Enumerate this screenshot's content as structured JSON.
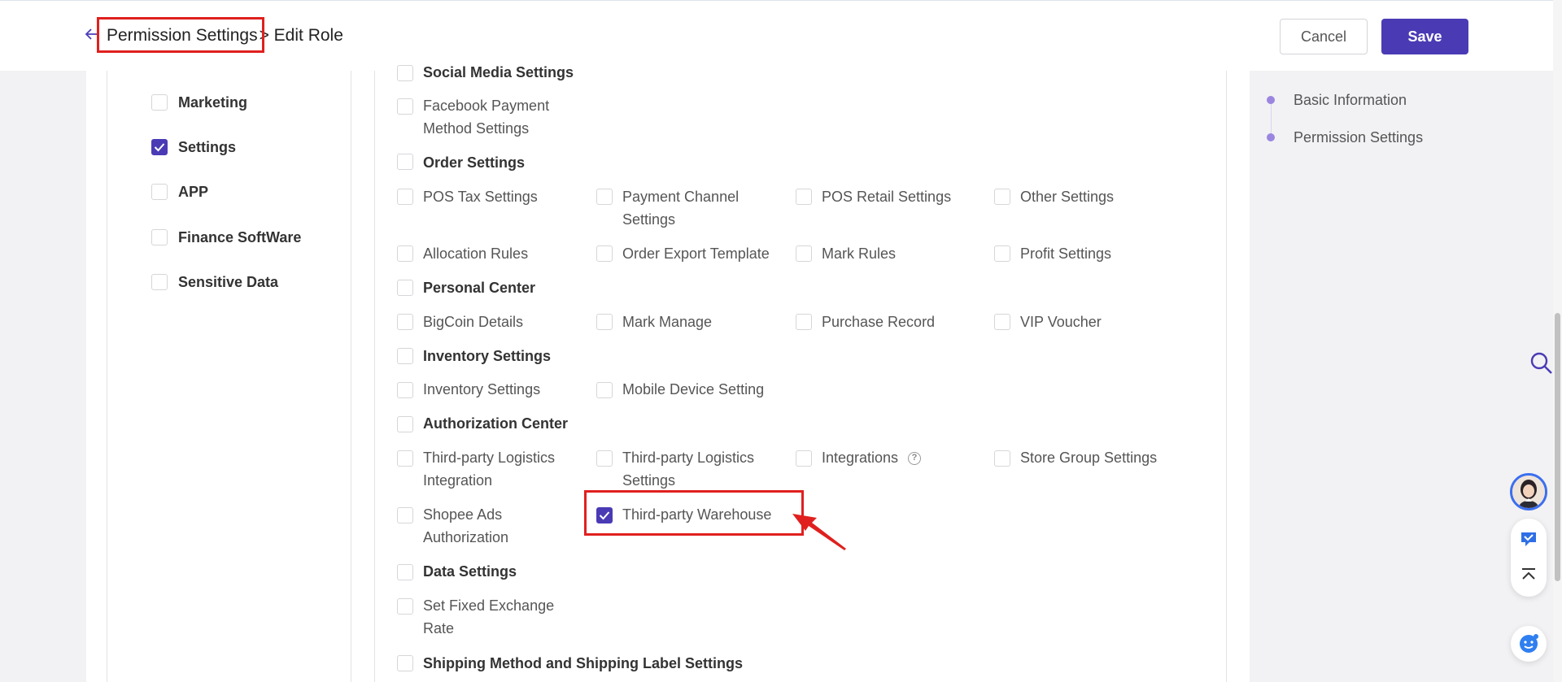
{
  "header": {
    "breadcrumb_parent": "Permission Settings",
    "breadcrumb_current": "> Edit Role",
    "cancel_label": "Cancel",
    "save_label": "Save"
  },
  "modules": [
    {
      "label": "Marketing",
      "checked": false
    },
    {
      "label": "Settings",
      "checked": true
    },
    {
      "label": "APP",
      "checked": false
    },
    {
      "label": "Finance SoftWare",
      "checked": false
    },
    {
      "label": "Sensitive Data",
      "checked": false
    }
  ],
  "permissions": {
    "social_media": {
      "title": "Social Media Settings",
      "items": [
        "Facebook Payment Method Settings"
      ]
    },
    "order": {
      "title": "Order Settings",
      "items": [
        "POS Tax Settings",
        "Payment Channel Settings",
        "POS Retail Settings",
        "Other Settings",
        "Allocation Rules",
        "Order Export Template",
        "Mark Rules",
        "Profit Settings"
      ]
    },
    "personal": {
      "title": "Personal Center",
      "items": [
        "BigCoin Details",
        "Mark Manage",
        "Purchase Record",
        "VIP Voucher"
      ]
    },
    "inventory": {
      "title": "Inventory Settings",
      "items": [
        "Inventory Settings",
        "Mobile Device Setting"
      ]
    },
    "authorization": {
      "title": "Authorization Center",
      "items": [
        "Third-party Logistics Integration",
        "Third-party Logistics Settings",
        "Integrations",
        "Store Group Settings",
        "Shopee Ads Authorization",
        "Third-party Warehouse"
      ]
    },
    "data": {
      "title": "Data Settings",
      "items": [
        "Set Fixed Exchange Rate"
      ]
    },
    "shipping": {
      "title": "Shipping Method and Shipping Label Settings"
    }
  },
  "right_nav": [
    "Basic Information",
    "Permission Settings"
  ],
  "colors": {
    "accent": "#4a3bb5",
    "annotation": "#e0201f"
  }
}
